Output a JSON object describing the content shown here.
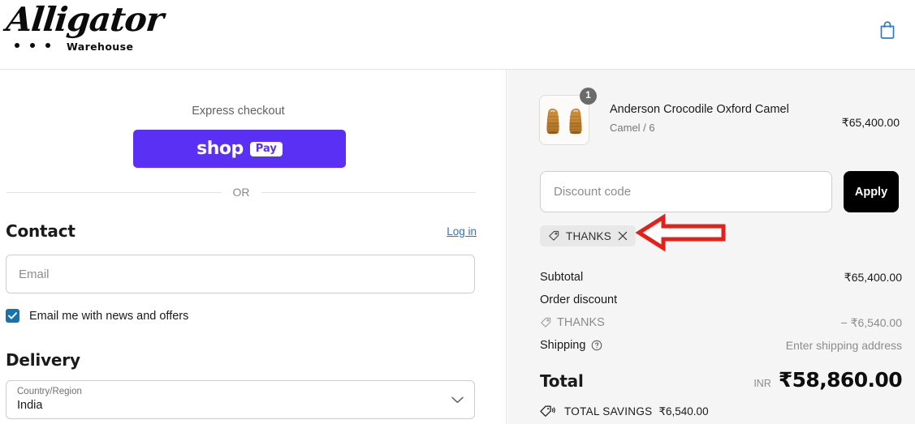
{
  "header": {
    "logo_script": "Alligator",
    "logo_sub": "Warehouse",
    "cart_icon": "shopping-bag-icon"
  },
  "left": {
    "express_label": "Express checkout",
    "shop_pay": {
      "word": "shop",
      "pill": "Pay"
    },
    "or_text": "OR",
    "contact": {
      "title": "Contact",
      "login_label": "Log in",
      "email_value": "",
      "email_placeholder": "Email",
      "news_label": "Email me with news and offers",
      "news_checked": true,
      "check_icon": "checkmark-icon"
    },
    "delivery": {
      "title": "Delivery",
      "country_label": "Country/Region",
      "country_value": "India",
      "chevron_icon": "chevron-down-icon"
    }
  },
  "right": {
    "product": {
      "title": "Anderson Crocodile Oxford Camel",
      "variant": "Camel / 6",
      "price": "₹65,400.00",
      "quantity": "1",
      "image_alt": "camel-crocodile-oxford-shoes"
    },
    "discount": {
      "input_value": "",
      "input_placeholder": "Discount code",
      "apply_label": "Apply",
      "chip_label": "THANKS",
      "chip_tag_icon": "discount-tag-icon",
      "chip_remove_icon": "close-icon"
    },
    "summary": {
      "subtotal_label": "Subtotal",
      "subtotal_value": "₹65,400.00",
      "order_discount_label": "Order discount",
      "order_discount_value": "",
      "discount_code_label": "THANKS",
      "discount_code_value": "− ₹6,540.00",
      "discount_tag_icon": "discount-tag-icon",
      "shipping_label": "Shipping",
      "shipping_help_icon": "help-circle-icon",
      "shipping_value": "Enter shipping address",
      "total_label": "Total",
      "total_currency": "INR",
      "total_value": "₹58,860.00",
      "savings_icon": "savings-tag-icon",
      "savings_label": "TOTAL SAVINGS",
      "savings_value": "₹6,540.00"
    }
  },
  "annotation": {
    "arrow_icon": "left-pointing-arrow-annotation",
    "arrow_color": "#E32119"
  },
  "colors": {
    "shop_pay_purple": "#5A31F4",
    "link_blue": "#2B6FD4",
    "checkbox_blue": "#1773B0",
    "cart_icon_blue": "#2E7CC4",
    "panel_gray": "#F5F5F5",
    "apply_black": "#000000"
  }
}
